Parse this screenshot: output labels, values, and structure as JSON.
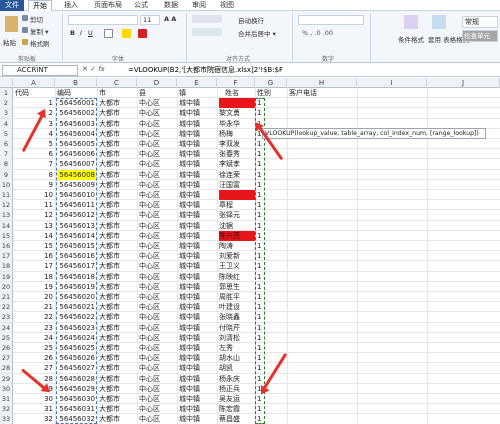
{
  "ribbon": {
    "tabs": [
      "文件",
      "开始",
      "插入",
      "页面布局",
      "公式",
      "数据",
      "审阅",
      "视图"
    ],
    "active_tab": "开始",
    "clipboard": {
      "paste": "粘贴",
      "cut": "剪切",
      "copy": "复制 ▾",
      "format_painter": "格式刷",
      "group": "剪贴板"
    },
    "font": {
      "size": "11",
      "group": "字体"
    },
    "alignment": {
      "wrap": "自动换行",
      "merge": "合并后居中 ▾",
      "group": "对齐方式"
    },
    "number": {
      "format": "常规",
      "group": "数字"
    },
    "styles": {
      "conditional": "条件格式",
      "table": "套用\n表格格式",
      "check_cell": "检查单元"
    }
  },
  "formula_bar": {
    "name_box": "ACCRINT",
    "x": "✕",
    "check": "✓",
    "fx": "fx",
    "formula": "=VLOOKUP(B2,'[大都市院宿信息.xlsx]2'!$B:$F"
  },
  "columns": [
    "A",
    "B",
    "C",
    "D",
    "E",
    "F",
    "G",
    "H",
    "I",
    "J"
  ],
  "headers": {
    "a": "代码",
    "b": "编码",
    "c": "市",
    "d": "县",
    "e": "镇",
    "f": "姓名",
    "g": "性别",
    "h": "客户电话"
  },
  "rows": [
    {
      "n": "2",
      "a": "1",
      "b": "56456001",
      "c": "大都市",
      "d": "中心区",
      "e": "城中镇",
      "f": "",
      "g": "1",
      "fred": true
    },
    {
      "n": "3",
      "a": "2",
      "b": "56456002",
      "c": "大都市",
      "d": "中心区",
      "e": "城中镇",
      "f": "黎文勇",
      "g": "1"
    },
    {
      "n": "4",
      "a": "3",
      "b": "56456003",
      "c": "大都市",
      "d": "中心区",
      "e": "城中镇",
      "f": "毕永华",
      "g": "1"
    },
    {
      "n": "5",
      "a": "4",
      "b": "56456004",
      "c": "大都市",
      "d": "中心区",
      "e": "城中镇",
      "f": "杨梅",
      "g": "1"
    },
    {
      "n": "6",
      "a": "5",
      "b": "56456005",
      "c": "大都市",
      "d": "中心区",
      "e": "城中镇",
      "f": "李双发",
      "g": "1"
    },
    {
      "n": "7",
      "a": "6",
      "b": "56456006",
      "c": "大都市",
      "d": "中心区",
      "e": "城中镇",
      "f": "张春秀",
      "g": "1"
    },
    {
      "n": "8",
      "a": "7",
      "b": "56456007",
      "c": "大都市",
      "d": "中心区",
      "e": "城中镇",
      "f": "李斌孝",
      "g": "1"
    },
    {
      "n": "9",
      "a": "8",
      "b": "56456008",
      "c": "大都市",
      "d": "中心区",
      "e": "城中镇",
      "f": "徐连荣",
      "g": "1",
      "byellow": true
    },
    {
      "n": "10",
      "a": "9",
      "b": "56456009",
      "c": "大都市",
      "d": "中心区",
      "e": "城中镇",
      "f": "汪国富",
      "g": "1"
    },
    {
      "n": "11",
      "a": "10",
      "b": "56456010",
      "c": "大都市",
      "d": "中心区",
      "e": "城中镇",
      "f": "",
      "g": "1",
      "fred": true
    },
    {
      "n": "12",
      "a": "11",
      "b": "56456011",
      "c": "大都市",
      "d": "中心区",
      "e": "城中镇",
      "f": "章程",
      "g": "1"
    },
    {
      "n": "13",
      "a": "12",
      "b": "56456012",
      "c": "大都市",
      "d": "中心区",
      "e": "城中镇",
      "f": "张铎元",
      "g": "1"
    },
    {
      "n": "14",
      "a": "13",
      "b": "56456013",
      "c": "大都市",
      "d": "中心区",
      "e": "城中镇",
      "f": "沈据",
      "g": "1"
    },
    {
      "n": "15",
      "a": "14",
      "b": "56456014",
      "c": "大都市",
      "d": "中心区",
      "e": "城中镇",
      "f": "陈兴亮",
      "g": "1",
      "fred": true
    },
    {
      "n": "16",
      "a": "15",
      "b": "56456015",
      "c": "大都市",
      "d": "中心区",
      "e": "城中镇",
      "f": "陶涛",
      "g": "1"
    },
    {
      "n": "17",
      "a": "16",
      "b": "56456016",
      "c": "大都市",
      "d": "中心区",
      "e": "城中镇",
      "f": "刘爱新",
      "g": "1"
    },
    {
      "n": "18",
      "a": "17",
      "b": "56456017",
      "c": "大都市",
      "d": "中心区",
      "e": "城中镇",
      "f": "王卫义",
      "g": "1"
    },
    {
      "n": "19",
      "a": "18",
      "b": "56456018",
      "c": "大都市",
      "d": "中心区",
      "e": "城中镇",
      "f": "陈映红",
      "g": "1"
    },
    {
      "n": "20",
      "a": "19",
      "b": "56456019",
      "c": "大都市",
      "d": "中心区",
      "e": "城中镇",
      "f": "郭思生",
      "g": "1"
    },
    {
      "n": "21",
      "a": "20",
      "b": "56456020",
      "c": "大都市",
      "d": "中心区",
      "e": "城中镇",
      "f": "周胜平",
      "g": "1"
    },
    {
      "n": "22",
      "a": "21",
      "b": "56456021",
      "c": "大都市",
      "d": "中心区",
      "e": "城中镇",
      "f": "叶建设",
      "g": "1"
    },
    {
      "n": "23",
      "a": "22",
      "b": "56456022",
      "c": "大都市",
      "d": "中心区",
      "e": "城中镇",
      "f": "张晓鑫",
      "g": "1"
    },
    {
      "n": "24",
      "a": "23",
      "b": "56456023",
      "c": "大都市",
      "d": "中心区",
      "e": "城中镇",
      "f": "付晓芹",
      "g": "1"
    },
    {
      "n": "25",
      "a": "24",
      "b": "56456024",
      "c": "大都市",
      "d": "中心区",
      "e": "城中镇",
      "f": "刘清松",
      "g": "1"
    },
    {
      "n": "26",
      "a": "25",
      "b": "56456025",
      "c": "大都市",
      "d": "中心区",
      "e": "城中镇",
      "f": "左秀",
      "g": "1"
    },
    {
      "n": "27",
      "a": "26",
      "b": "56456026",
      "c": "大都市",
      "d": "中心区",
      "e": "城中镇",
      "f": "胡水山",
      "g": "1"
    },
    {
      "n": "28",
      "a": "27",
      "b": "56456027",
      "c": "大都市",
      "d": "中心区",
      "e": "城中镇",
      "f": "胡凯",
      "g": "1"
    },
    {
      "n": "29",
      "a": "28",
      "b": "56456028",
      "c": "大都市",
      "d": "中心区",
      "e": "城中镇",
      "f": "杨永庆",
      "g": "1"
    },
    {
      "n": "30",
      "a": "29",
      "b": "56456029",
      "c": "大都市",
      "d": "中心区",
      "e": "城中镇",
      "f": "杨正兵",
      "g": "1"
    },
    {
      "n": "31",
      "a": "30",
      "b": "56456030",
      "c": "大都市",
      "d": "中心区",
      "e": "城中镇",
      "f": "吴友运",
      "g": "1"
    },
    {
      "n": "32",
      "a": "31",
      "b": "56456031",
      "c": "大都市",
      "d": "中心区",
      "e": "城中镇",
      "f": "陈宏霞",
      "g": "1"
    },
    {
      "n": "33",
      "a": "32",
      "b": "56456032",
      "c": "大都市",
      "d": "中心区",
      "e": "城中镇",
      "f": "蔡昌盛",
      "g": "1"
    },
    {
      "n": "34",
      "a": "33",
      "b": "56456033",
      "c": "大都市",
      "d": "中心区",
      "e": "城中镇",
      "f": "黎毒萍",
      "g": "1"
    }
  ],
  "tooltip": {
    "text": "VLOOKUP(lookup_value, table_array, col_index_num, [range_lookup])"
  },
  "colors": {
    "highlight_red": "#e8151b",
    "highlight_yellow": "#ffff00",
    "arrow": "#e6302b",
    "ribbon_blue": "#2a579a"
  }
}
